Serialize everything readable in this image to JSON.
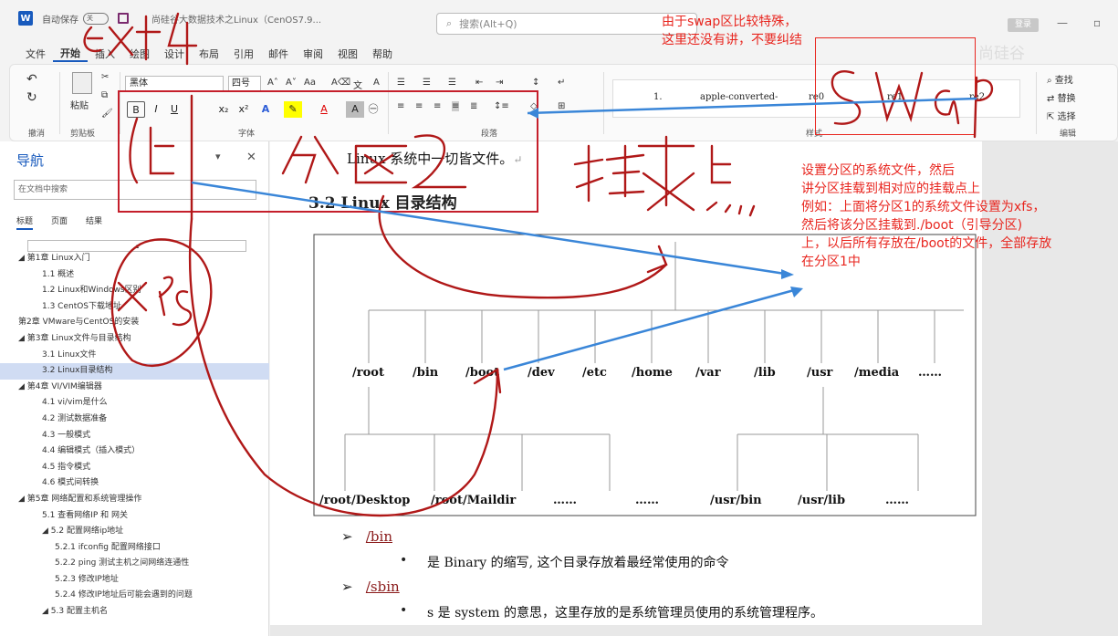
{
  "titlebar": {
    "app_icon": "W",
    "autosave_label": "自动保存",
    "autosave_state": "关",
    "doc_title": "尚硅谷大数据技术之Linux（CenOS7.9...",
    "search_placeholder": "搜索(Alt+Q)",
    "login": "登录"
  },
  "menu": [
    "文件",
    "开始",
    "插入",
    "绘图",
    "设计",
    "布局",
    "引用",
    "邮件",
    "审阅",
    "视图",
    "帮助"
  ],
  "ribbon": {
    "undo_label": "撤消",
    "paste_label": "粘贴",
    "clipboard_label": "剪贴板",
    "font_name": "黑体",
    "font_size": "四号",
    "font_label": "字体",
    "paragraph_label": "段落",
    "styles_label": "样式",
    "edit_label": "编辑",
    "styles": [
      "1.",
      "apple-converted-",
      "re0",
      "re1",
      "re2"
    ],
    "find": "查找",
    "replace": "替换",
    "select": "选择",
    "format_buttons": [
      "B",
      "I",
      "U",
      "x₂",
      "x²",
      "A",
      "A"
    ]
  },
  "nav": {
    "title": "导航",
    "search_placeholder": "在文档中搜索",
    "tabs": [
      "标题",
      "页面",
      "结果"
    ],
    "items": [
      {
        "text": "◢  第1章 Linux入门",
        "level": 0
      },
      {
        "text": "1.1 概述",
        "level": 1
      },
      {
        "text": "1.2 Linux和Windows区别",
        "level": 1
      },
      {
        "text": "1.3 CentOS下载地址",
        "level": 1
      },
      {
        "text": "第2章 VMware与CentOS的安装",
        "level": 0
      },
      {
        "text": "◢  第3章 Linux文件与目录结构",
        "level": 0
      },
      {
        "text": "3.1 Linux文件",
        "level": 1
      },
      {
        "text": "3.2 Linux目录结构",
        "level": 1,
        "selected": true
      },
      {
        "text": "◢  第4章 VI/VIM编辑器",
        "level": 0
      },
      {
        "text": "4.1 vi/vim是什么",
        "level": 1
      },
      {
        "text": "4.2 测试数据准备",
        "level": 1
      },
      {
        "text": "4.3 一般模式",
        "level": 1
      },
      {
        "text": "4.4 编辑模式（插入模式）",
        "level": 1
      },
      {
        "text": "4.5 指令模式",
        "level": 1
      },
      {
        "text": "4.6 模式间转换",
        "level": 1
      },
      {
        "text": "◢  第5章 网络配置和系统管理操作",
        "level": 0
      },
      {
        "text": "5.1 查看网络IP 和 网关",
        "level": 1
      },
      {
        "text": "◢  5.2 配置网络ip地址",
        "level": 1
      },
      {
        "text": "5.2.1 ifconfig 配置网络接口",
        "level": 2
      },
      {
        "text": "5.2.2 ping 测试主机之间网络连通性",
        "level": 2
      },
      {
        "text": "5.2.3 修改IP地址",
        "level": 2
      },
      {
        "text": "5.2.4 修改IP地址后可能会遇到的问题",
        "level": 2
      },
      {
        "text": "◢  5.3 配置主机名",
        "level": 1
      }
    ]
  },
  "document": {
    "line1": "Linux 系统中一切皆文件。",
    "heading": "3.2 Linux 目录结构",
    "top_dirs": [
      "/root",
      "/bin",
      "/boot",
      "/dev",
      "/etc",
      "/home",
      "/var",
      "/lib",
      "/usr",
      "/media",
      "……"
    ],
    "sub_dirs": [
      "/root/Desktop",
      "/root/Maildir",
      "……",
      "……",
      "/usr/bin",
      "/usr/lib",
      "……"
    ],
    "bin_head": "/bin",
    "bin_desc": "是 Binary 的缩写, 这个目录存放着最经常使用的命令",
    "sbin_head": "/sbin",
    "sbin_desc": "s 是 system 的意思，这里存放的是系统管理员使用的系统管理程序。"
  },
  "annotations": {
    "swap_note": [
      "由于swap区比较特殊，",
      "这里还没有讲，不要纠结"
    ],
    "mount_note": [
      "设置分区的系统文件，然后",
      "讲分区挂载到相对应的挂载点上",
      "例如：上面将分区1的系统文件设置为xfs，",
      "然后将该分区挂载到./boot（引导分区)",
      "上，以后所有存放在/boot的文件，全部存放",
      "在分区1中"
    ]
  },
  "watermark": "尚硅谷"
}
